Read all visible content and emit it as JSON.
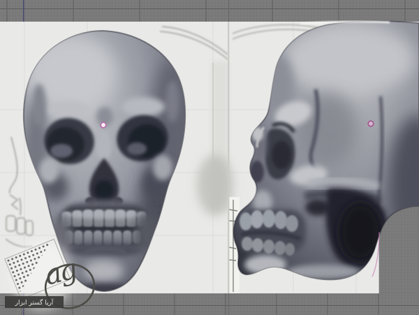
{
  "app": {
    "type": "3d-sculpting-viewport-screenshots",
    "panels": [
      {
        "id": "front-view-panel"
      },
      {
        "id": "side-view-panel"
      }
    ]
  },
  "watermark": {
    "logo_text": "ag",
    "company_text": "آریا گستر ابزار"
  },
  "colors": {
    "viewport_grid_dark": "#7c7c7c",
    "grid_line_fine": "#717171",
    "grid_line_major": "#5e5e5e",
    "background_light": "#e9e9e7",
    "axis_blue": "#4b4b72",
    "marker_pink": "#b868a8",
    "skull_midtone": "#90929c",
    "socket_dark": "#24262f"
  }
}
